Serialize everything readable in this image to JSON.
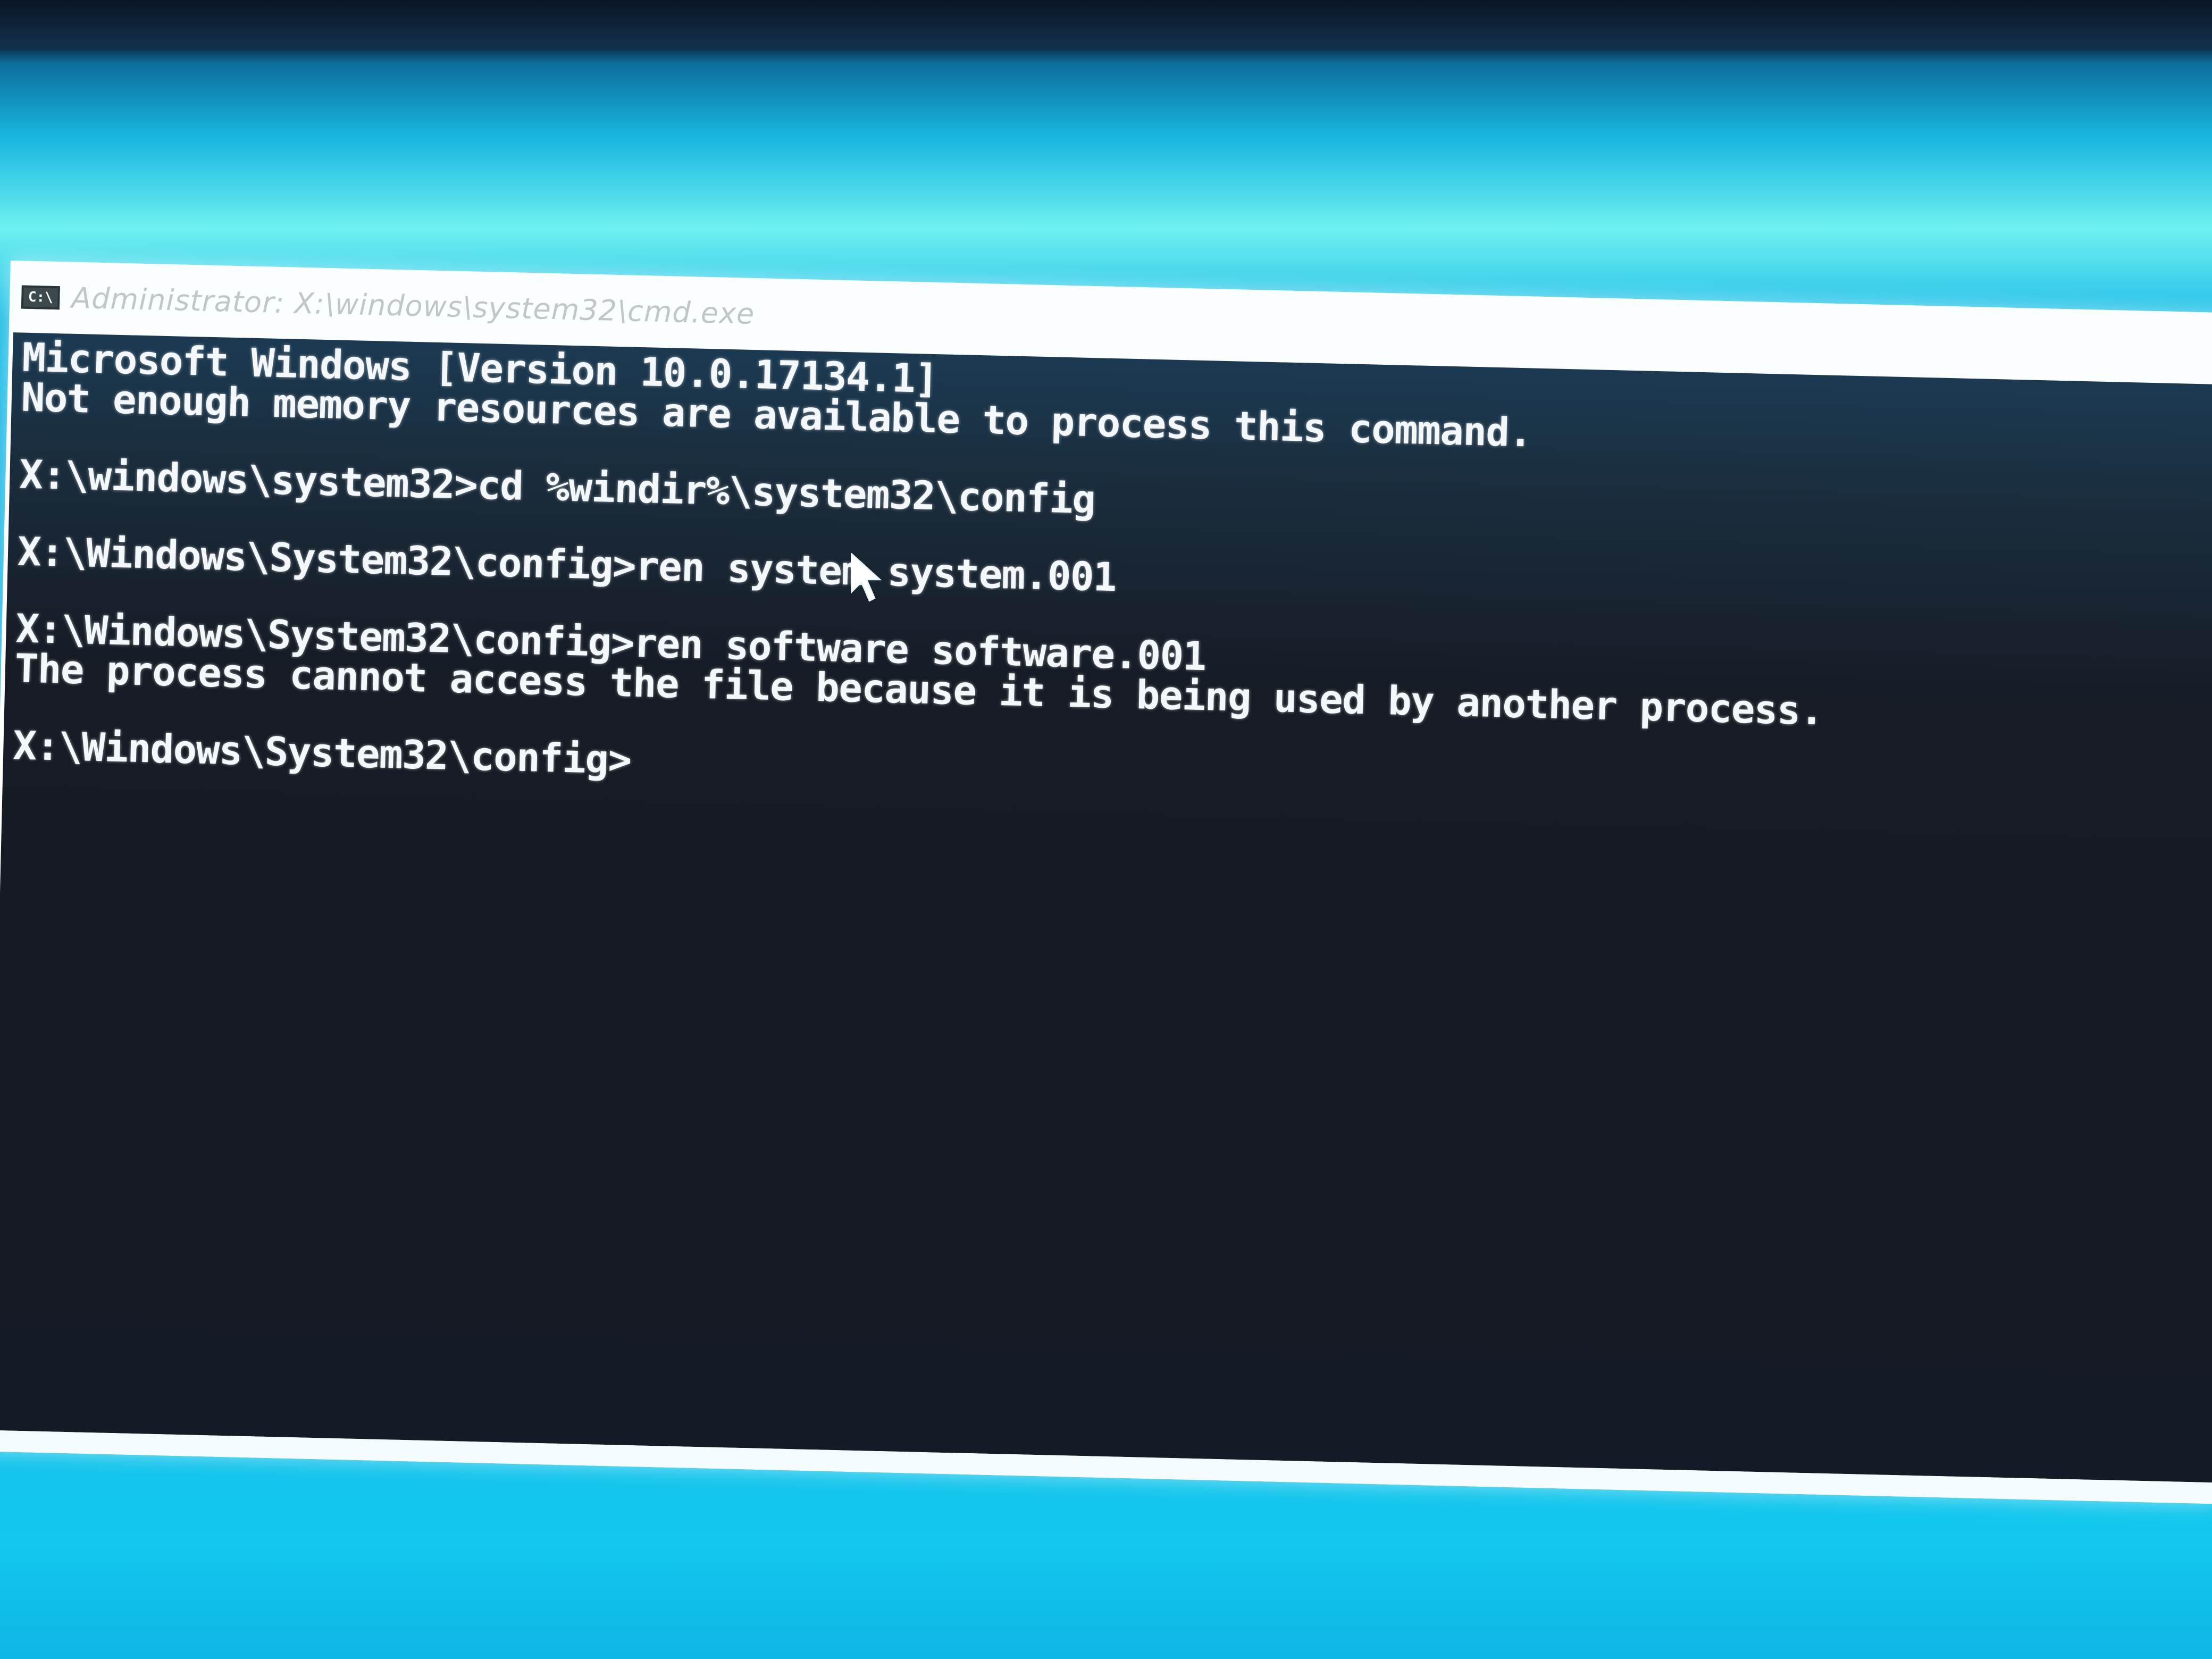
{
  "window": {
    "icon": "cmd-icon",
    "icon_glyph": "C:\\",
    "title": "Administrator: X:\\windows\\system32\\cmd.exe"
  },
  "console": {
    "lines": [
      "Microsoft Windows [Version 10.0.17134.1]",
      "Not enough memory resources are available to process this command.",
      "",
      "X:\\windows\\system32>cd %windir%\\system32\\config",
      "",
      "X:\\Windows\\System32\\config>ren system system.001",
      "",
      "X:\\Windows\\System32\\config>ren software software.001",
      "The process cannot access the file because it is being used by another process.",
      "",
      "X:\\Windows\\System32\\config>"
    ]
  },
  "colors": {
    "console_background": "#161a24",
    "console_text": "#f4f8fa",
    "desktop_background": "#1aa5db",
    "title_bar": "#fbfeff"
  }
}
